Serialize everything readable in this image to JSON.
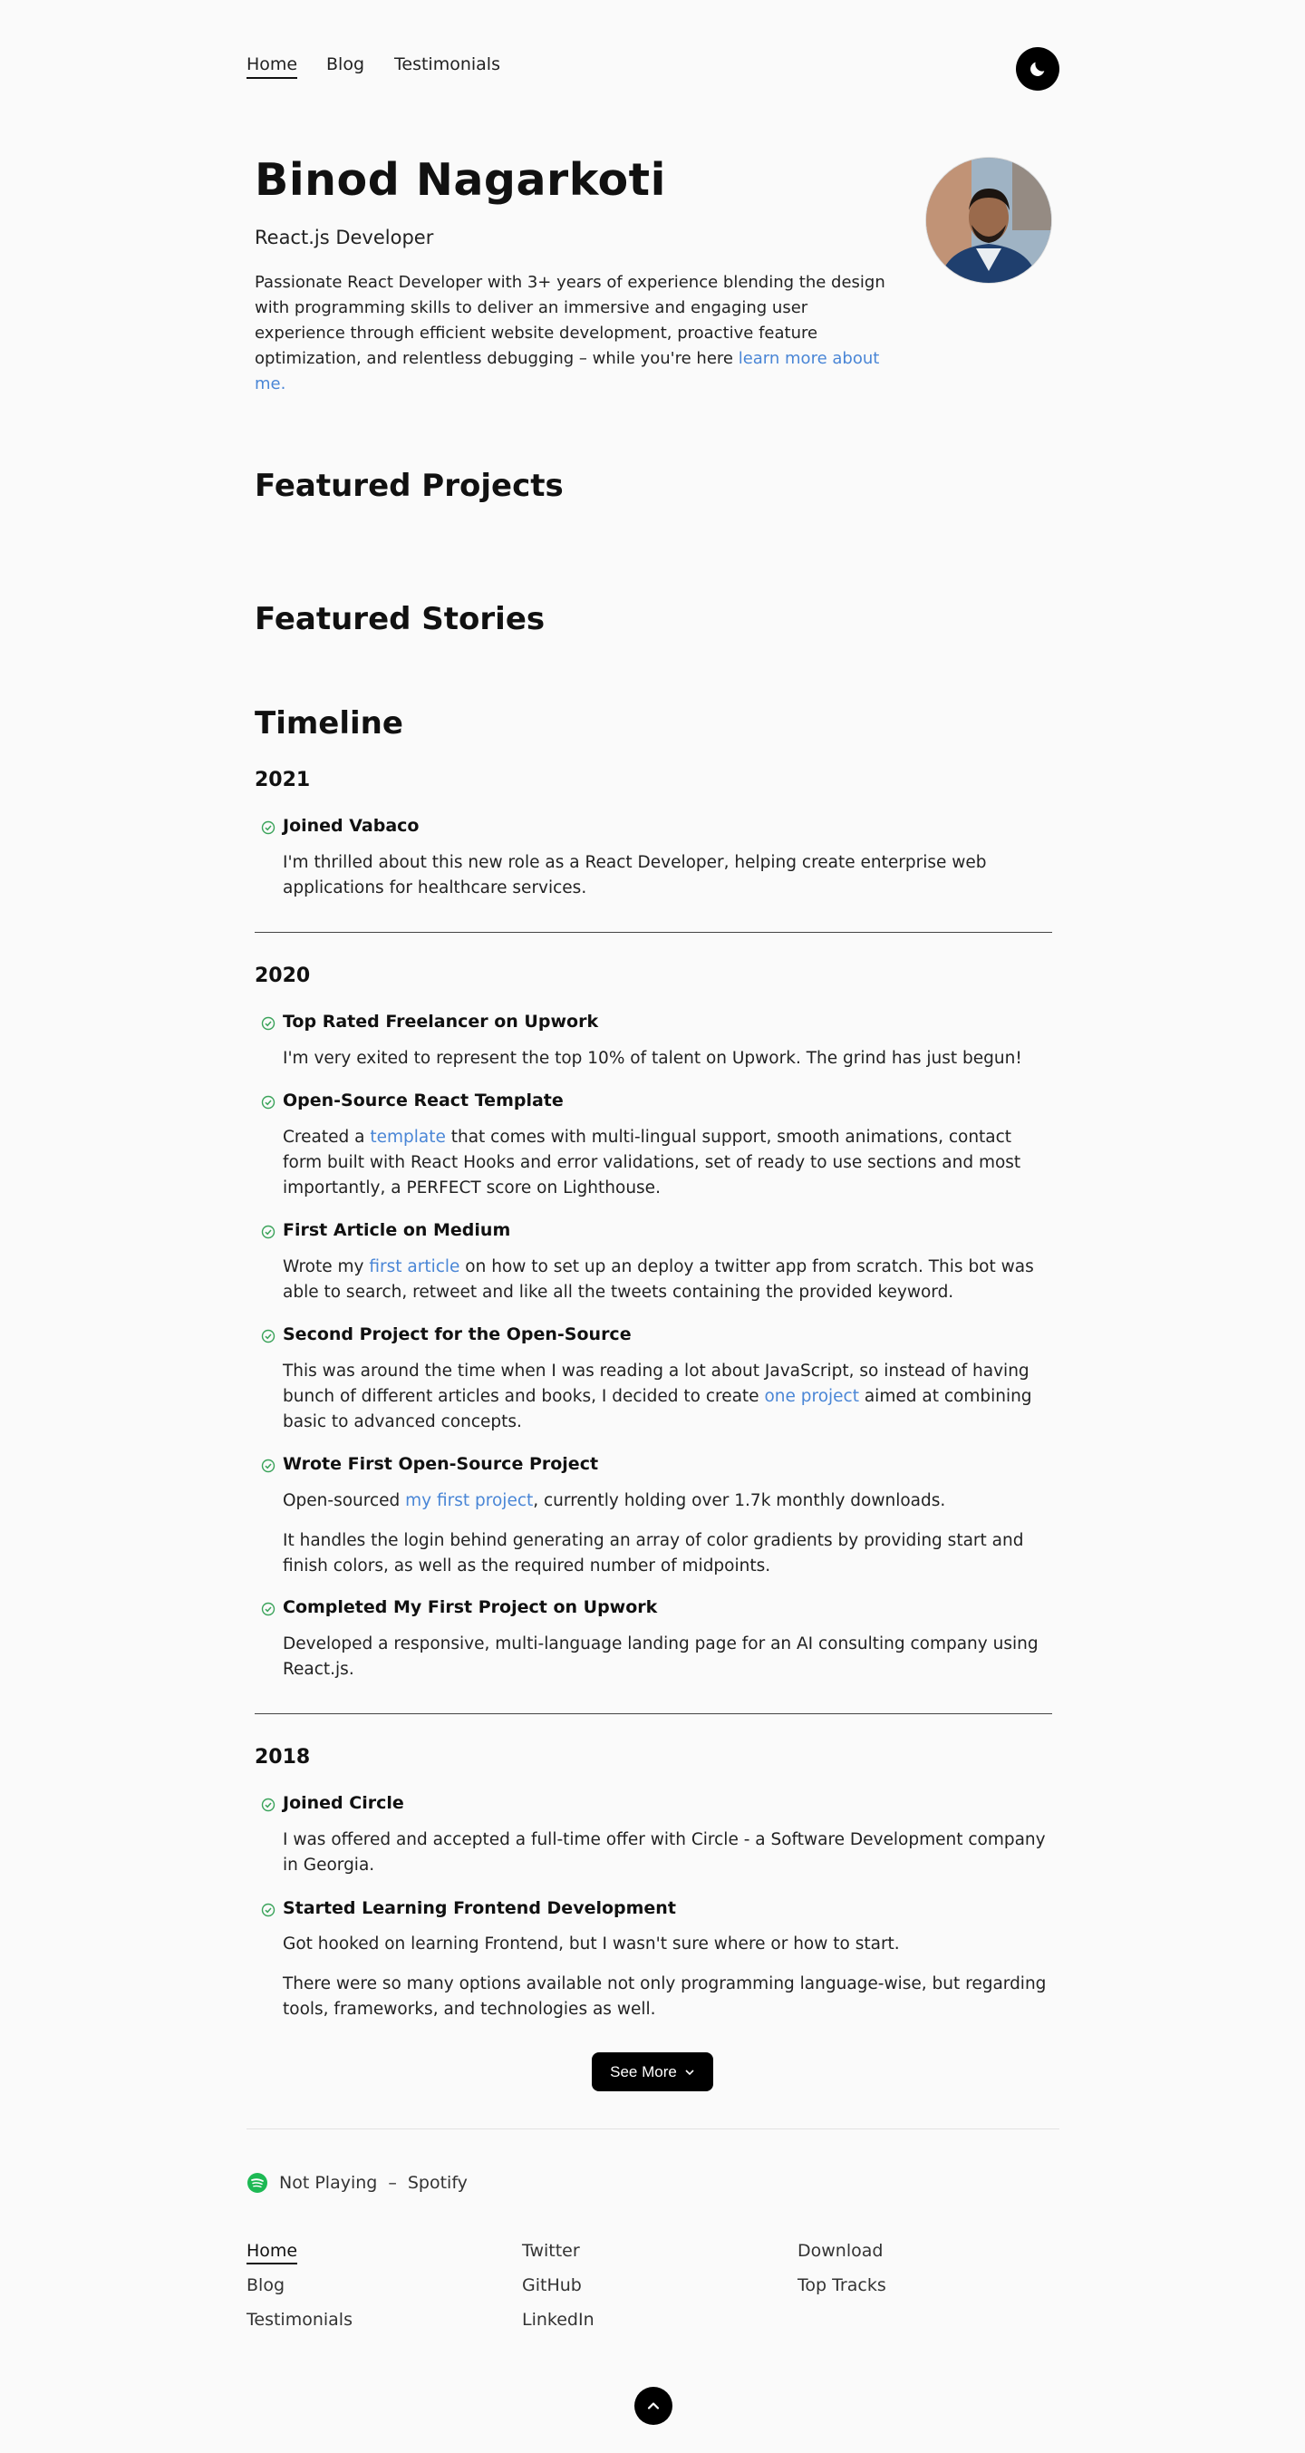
{
  "nav": {
    "items": [
      "Home",
      "Blog",
      "Testimonials"
    ],
    "theme_toggle_icon": "moon-icon"
  },
  "hero": {
    "name": "Binod Nagarkoti",
    "role": "React.js Developer",
    "bio_prefix": "Passionate React Developer with 3+ years of experience blending the design with programming skills to deliver an immersive and engaging user experience through efficient website development, proactive feature optimization, and relentless debugging –  while you're here ",
    "bio_link": "learn more about me."
  },
  "sections": {
    "projects": "Featured Projects",
    "stories": "Featured Stories",
    "timeline": "Timeline"
  },
  "timeline": {
    "y2021": {
      "year": "2021",
      "e1_title": "Joined Vabaco",
      "e1_text": "I'm thrilled about this new role as a React Developer, helping create enterprise web applications for healthcare services."
    },
    "y2020": {
      "year": "2020",
      "e1_title": "Top Rated Freelancer on Upwork",
      "e1_text": "I'm very exited to represent the top 10% of talent on Upwork. The grind has just begun!",
      "e2_title": "Open-Source React Template",
      "e2_pre": "Created a ",
      "e2_link": "template",
      "e2_post": " that comes with multi-lingual support, smooth animations, contact form built with React Hooks and error validations, set of ready to use sections and most importantly, a PERFECT score on Lighthouse.",
      "e3_title": "First Article on Medium",
      "e3_pre": "Wrote my ",
      "e3_link": "first article",
      "e3_post": " on how to set up an deploy a twitter app from scratch. This bot was able to search, retweet and like all the tweets containing the provided keyword.",
      "e4_title": "Second Project for the Open-Source",
      "e4_pre": "This was around the time when I was reading a lot about JavaScript, so instead of having bunch of different articles and books, I decided to create ",
      "e4_link": "one project",
      "e4_post": " aimed at combining basic to advanced concepts.",
      "e5_title": "Wrote First Open-Source Project",
      "e5_pre": "Open-sourced ",
      "e5_link": "my first project",
      "e5_post": ", currently holding over 1.7k monthly downloads.",
      "e5_text2": "It handles the login behind generating an array of color gradients by providing start and finish colors, as well as the required number of midpoints.",
      "e6_title": "Completed My First Project on Upwork",
      "e6_text": "Developed a responsive, multi-language landing page for an AI consulting company using React.js."
    },
    "y2018": {
      "year": "2018",
      "e1_title": "Joined Circle",
      "e1_text": "I was offered and accepted a full-time offer with Circle - a Software Development company in Georgia.",
      "e2_title": "Started Learning Frontend Development",
      "e2_text1": "Got hooked on learning Frontend, but I wasn't sure where or how to start.",
      "e2_text2": "There were so many options available not only programming language-wise, but regarding tools, frameworks, and technologies as well."
    }
  },
  "see_more": "See More",
  "spotify": {
    "status": "Not Playing",
    "separator": "–",
    "service": "Spotify",
    "color": "#1db954"
  },
  "footer": {
    "col1": [
      "Home",
      "Blog",
      "Testimonials"
    ],
    "col2": [
      "Twitter",
      "GitHub",
      "LinkedIn"
    ],
    "col3": [
      "Download",
      "Top Tracks"
    ]
  },
  "colors": {
    "link": "#4a86d6",
    "check": "#3aa35a",
    "button": "#000000"
  }
}
